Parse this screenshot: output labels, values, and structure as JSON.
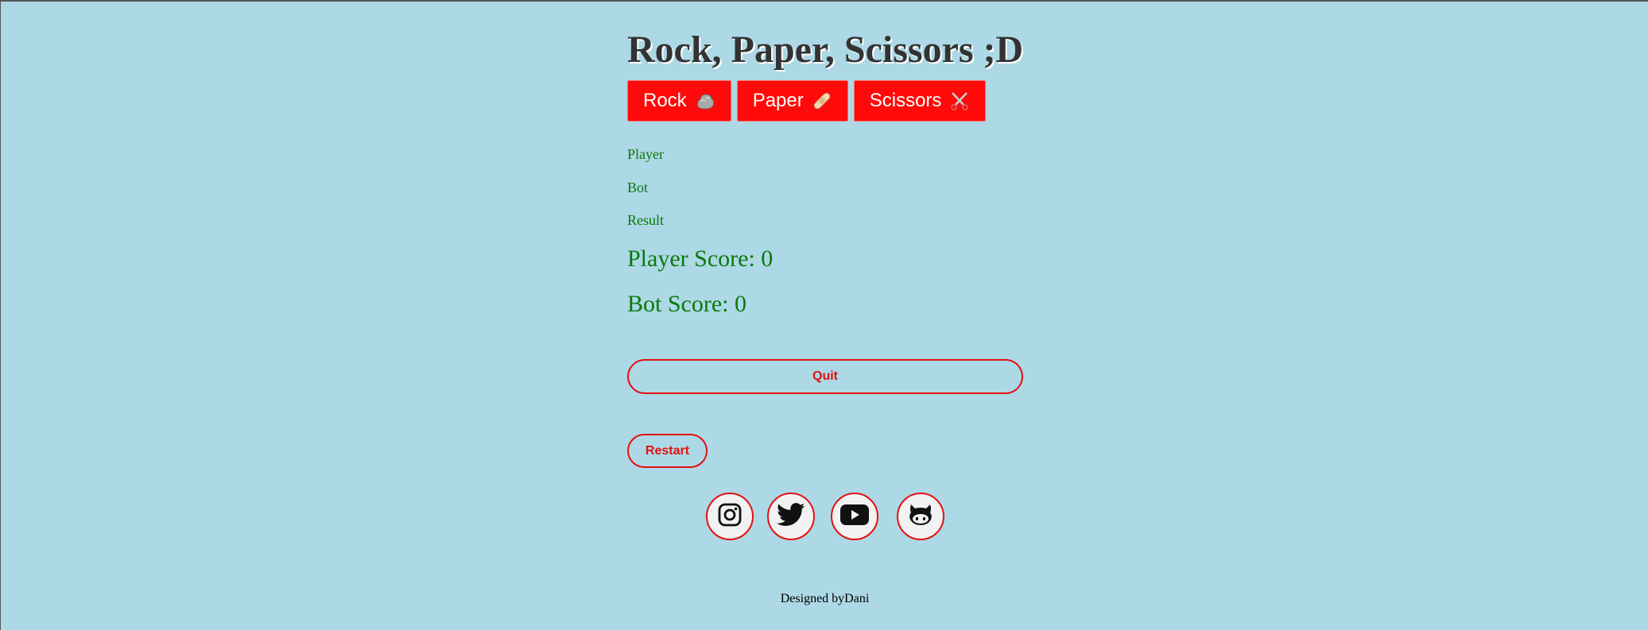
{
  "title": "Rock, Paper, Scissors ;D",
  "choices": [
    {
      "label": "Rock",
      "icon": "rock-emoji"
    },
    {
      "label": "Paper",
      "icon": "bandage-emoji"
    },
    {
      "label": "Scissors",
      "icon": "scissors-emoji"
    }
  ],
  "status": {
    "player": "Player",
    "bot": "Bot",
    "result": "Result"
  },
  "scores": {
    "player_label": "Player Score: 0",
    "bot_label": "Bot Score: 0"
  },
  "actions": {
    "quit_label": "Quit",
    "restart_label": "Restart"
  },
  "social": [
    {
      "name": "instagram-icon"
    },
    {
      "name": "twitter-icon"
    },
    {
      "name": "youtube-icon"
    },
    {
      "name": "github-icon"
    }
  ],
  "footer": {
    "text": "Designed byDani"
  },
  "colors": {
    "background": "#add8e6",
    "button_red": "#ff0a0a",
    "accent_red": "#e31010",
    "status_green": "#0a7a0a",
    "title": "#333333"
  }
}
